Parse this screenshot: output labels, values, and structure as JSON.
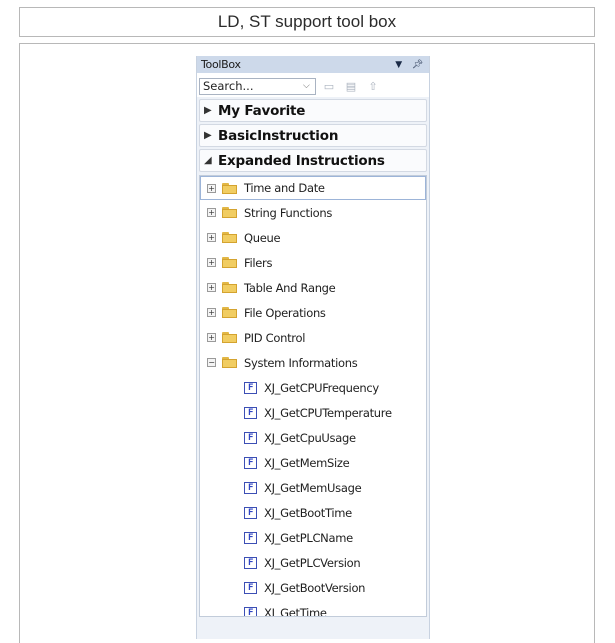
{
  "caption": "LD, ST support tool box",
  "toolbox": {
    "title": "ToolBox",
    "header_icons": [
      "dropdown-arrow-icon",
      "pin-icon"
    ],
    "search": {
      "placeholder": "Search..."
    },
    "toolbar_icons": [
      "folder-icon",
      "properties-icon",
      "up-arrow-icon"
    ],
    "sections": [
      {
        "label": "My Favorite",
        "expanded": false
      },
      {
        "label": "BasicInstruction",
        "expanded": false
      },
      {
        "label": "Expanded Instructions",
        "expanded": true
      }
    ],
    "folders": [
      {
        "label": "Time and Date",
        "expanded": false
      },
      {
        "label": "String Functions",
        "expanded": false
      },
      {
        "label": "Queue",
        "expanded": false
      },
      {
        "label": "Filers",
        "expanded": false
      },
      {
        "label": "Table And Range",
        "expanded": false
      },
      {
        "label": "File Operations",
        "expanded": false
      },
      {
        "label": "PID Control",
        "expanded": false
      },
      {
        "label": "System Informations",
        "expanded": true
      }
    ],
    "functions": [
      "XJ_GetCPUFrequency",
      "XJ_GetCPUTemperature",
      "XJ_GetCpuUsage",
      "XJ_GetMemSize",
      "XJ_GetMemUsage",
      "XJ_GetBootTime",
      "XJ_GetPLCName",
      "XJ_GetPLCVersion",
      "XJ_GetBootVersion",
      "XJ_GetTime"
    ]
  },
  "colors": {
    "header_bg": "#cdd9ea",
    "panel_bg": "#eef2f8",
    "folder": "#f1cd62",
    "function_icon": "#2f45c3"
  }
}
